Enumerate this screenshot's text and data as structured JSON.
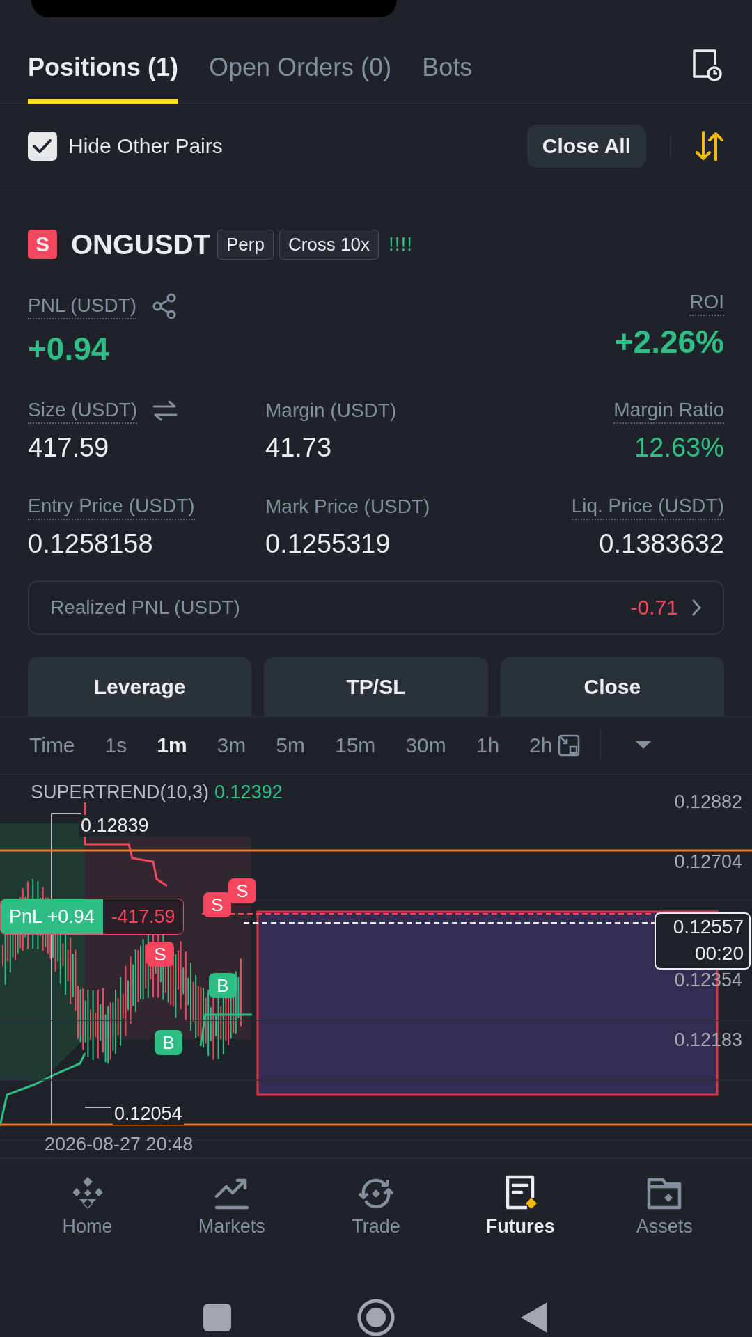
{
  "tabs": [
    {
      "label": "Positions (1)",
      "selected": true
    },
    {
      "label": "Open Orders (0)",
      "selected": false
    },
    {
      "label": "Bots",
      "selected": false
    }
  ],
  "filter": {
    "label": "Hide Other Pairs",
    "checked": true
  },
  "close_all": "Close All",
  "position": {
    "side": "S",
    "symbol": "ONGUSDT",
    "tags": [
      "Perp",
      "Cross 10x"
    ],
    "signal": "!!!!",
    "pnl_label": "PNL (USDT)",
    "pnl": "+0.94",
    "roi_label": "ROI",
    "roi": "+2.26%",
    "fields": [
      {
        "label": "Size (USDT)",
        "value": "417.59",
        "dotted": true,
        "kind": "swap",
        "positive": false
      },
      {
        "label": "Margin (USDT)",
        "value": "41.73",
        "dotted": false,
        "kind": "plain",
        "positive": false
      },
      {
        "label": "Margin Ratio",
        "value": "12.63%",
        "dotted": true,
        "kind": "plain",
        "positive": true
      },
      {
        "label": "Entry Price (USDT)",
        "value": "0.1258158",
        "dotted": true,
        "kind": "plain",
        "positive": false
      },
      {
        "label": "Mark Price (USDT)",
        "value": "0.1255319",
        "dotted": false,
        "kind": "plain",
        "positive": false
      },
      {
        "label": "Liq. Price (USDT)",
        "value": "0.1383632",
        "dotted": true,
        "kind": "plain",
        "positive": false
      }
    ],
    "realized": {
      "label": "Realized PNL (USDT)",
      "value": "-0.71"
    },
    "actions": [
      "Leverage",
      "TP/SL",
      "Close"
    ]
  },
  "chart": {
    "intervals": [
      {
        "label": "Time",
        "selected": false
      },
      {
        "label": "1s",
        "selected": false
      },
      {
        "label": "1m",
        "selected": true
      },
      {
        "label": "3m",
        "selected": false
      },
      {
        "label": "5m",
        "selected": false
      },
      {
        "label": "15m",
        "selected": false
      },
      {
        "label": "30m",
        "selected": false
      },
      {
        "label": "1h",
        "selected": false
      },
      {
        "label": "2h",
        "selected": false
      }
    ],
    "indicator": {
      "name": "SUPERTREND(10,3)",
      "value": "0.12392"
    },
    "price_labels": [
      "0.12882",
      "0.12704",
      "0.12354",
      "0.12183"
    ],
    "high": "0.12839",
    "low": "0.12054",
    "pnl_tag": {
      "pnl": "PnL +0.94",
      "size": "-417.59"
    },
    "markers": [
      {
        "kind": "sell",
        "label": "S"
      },
      {
        "kind": "sell",
        "label": "S"
      },
      {
        "kind": "sell",
        "label": "S"
      },
      {
        "kind": "buy",
        "label": "B"
      },
      {
        "kind": "buy",
        "label": "B"
      }
    ],
    "last_price": "0.12557",
    "countdown": "00:20",
    "date": "2026-08-27 20:48"
  },
  "nav": [
    {
      "label": "Home",
      "selected": false
    },
    {
      "label": "Markets",
      "selected": false
    },
    {
      "label": "Trade",
      "selected": false
    },
    {
      "label": "Futures",
      "selected": true
    },
    {
      "label": "Assets",
      "selected": false
    }
  ]
}
